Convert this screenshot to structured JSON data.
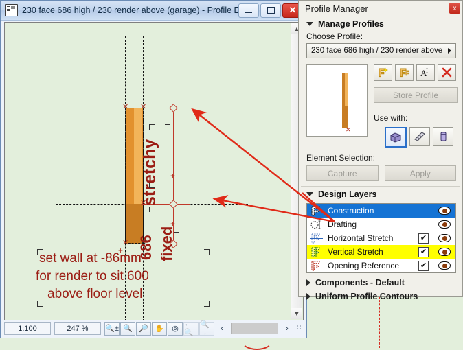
{
  "editor_window": {
    "title": "230 face 686 high / 230 render above (garage) - Profile E...",
    "title_icon": "profile-document-icon",
    "minimize_label": "Minimize",
    "maximize_label": "Maximize",
    "close_label": "✕"
  },
  "canvas": {
    "labels": {
      "stretchy": "stretchy",
      "dim_686": "686",
      "fixed": "fixed"
    },
    "note_lines": [
      "set wall at -86mm",
      "for render to sit 600",
      "above floor level"
    ]
  },
  "status_bar": {
    "scale": "1:100",
    "zoom": "247 %",
    "icons": [
      "zoom-set-icon",
      "zoom-in-icon",
      "zoom-out-icon",
      "pan-hand-icon",
      "fit-to-window-icon",
      "zoom-previous-icon",
      "zoom-next-icon"
    ],
    "scroll_left": "‹",
    "scroll_right": "›"
  },
  "profile_manager": {
    "title": "Profile Manager",
    "close_label": "x",
    "manage_profiles": {
      "section_label": "Manage Profiles",
      "choose_profile_label": "Choose Profile:",
      "selected_profile": "230 face 686 high / 230 render above ...",
      "buttons": [
        {
          "name": "new-profile-icon",
          "glyph": "⎇"
        },
        {
          "name": "duplicate-profile-icon",
          "glyph": "⎇"
        },
        {
          "name": "rename-profile-icon",
          "glyph": "A"
        },
        {
          "name": "delete-profile-icon",
          "glyph": "✕"
        }
      ],
      "store_profile_label": "Store Profile",
      "use_with_label": "Use with:",
      "use_with_options": [
        {
          "name": "wall-icon",
          "label": "Wall",
          "selected": true
        },
        {
          "name": "beam-icon",
          "label": "Beam",
          "selected": false
        },
        {
          "name": "column-icon",
          "label": "Column",
          "selected": false
        }
      ]
    },
    "element_selection": {
      "label": "Element Selection:",
      "capture_label": "Capture",
      "apply_label": "Apply"
    },
    "design_layers": {
      "section_label": "Design Layers",
      "rows": [
        {
          "name": "Construction",
          "checkbox": "none",
          "selected": true,
          "highlight": false
        },
        {
          "name": "Drafting",
          "checkbox": "none",
          "selected": false,
          "highlight": false
        },
        {
          "name": "Horizontal Stretch",
          "checkbox": "checked",
          "selected": false,
          "highlight": false
        },
        {
          "name": "Vertical Stretch",
          "checkbox": "checked",
          "selected": false,
          "highlight": true
        },
        {
          "name": "Opening Reference",
          "checkbox": "checked",
          "selected": false,
          "highlight": false
        }
      ],
      "check_glyph": "✔"
    },
    "collapsed_sections": [
      "Components - Default",
      "Uniform Profile Contours"
    ]
  },
  "colors": {
    "canvas_bg": "#e3efdc",
    "profile_fill": "#c87d23",
    "profile_stripe": "#f2b45a",
    "annotation_red": "#9b1d14",
    "arrow_red": "#e02a18",
    "selection_blue": "#1573d4",
    "highlight_yellow": "#ffff00",
    "construction_red": "#c0392b"
  }
}
